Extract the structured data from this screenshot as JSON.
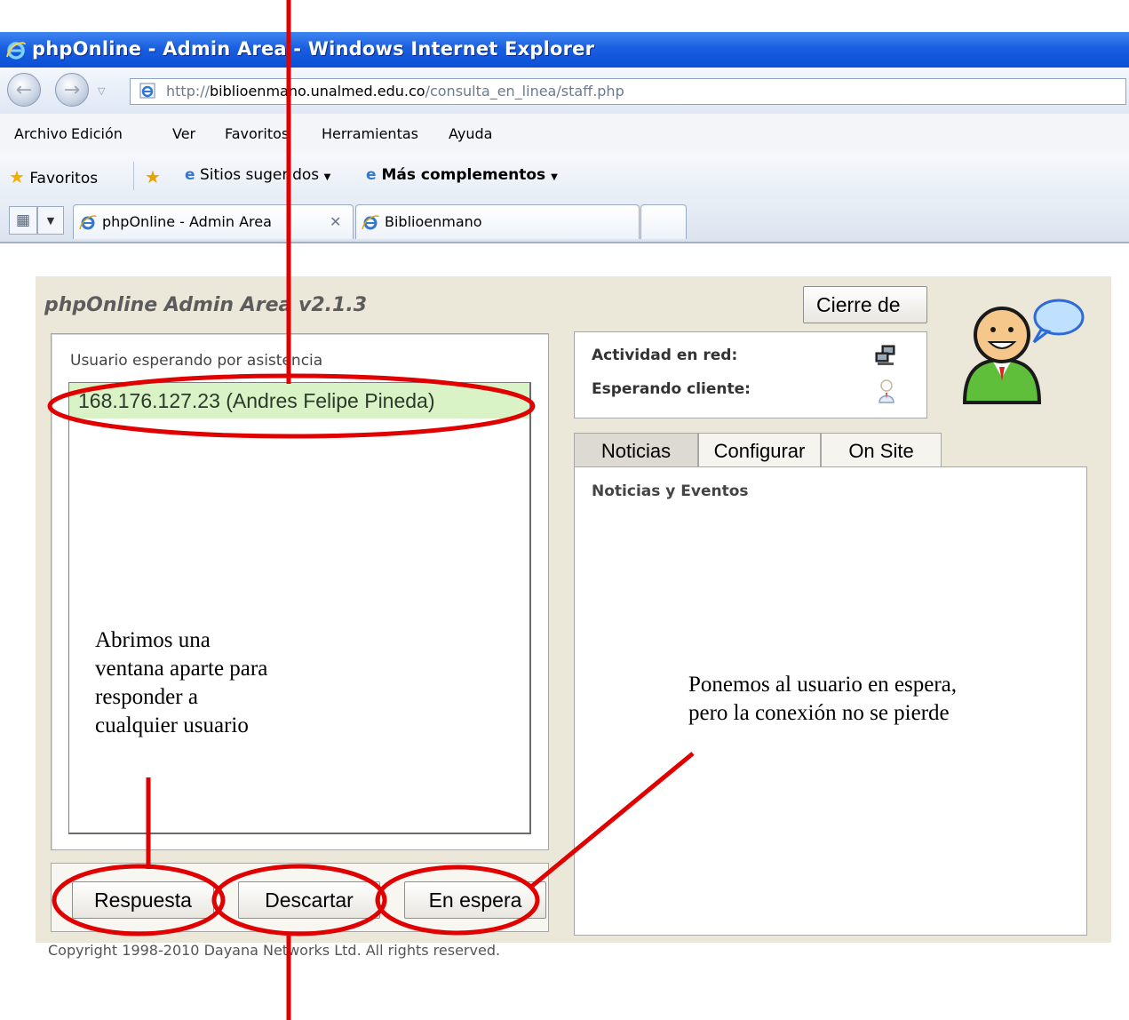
{
  "browser": {
    "window_title": "phpOnline - Admin Area - Windows Internet Explorer",
    "url": {
      "prefix": "http://",
      "host": "biblioenmano.unalmed.edu.co",
      "path": "/consulta_en_linea/staff.php"
    },
    "menu": [
      "Archivo",
      "Edición",
      "Ver",
      "Favoritos",
      "Herramientas",
      "Ayuda"
    ],
    "favorites_bar": {
      "favorites": "Favoritos",
      "suggested": "Sitios sugeridos",
      "addons": "Más complementos"
    },
    "tabs": [
      {
        "label": "phpOnline - Admin Area",
        "active": true
      },
      {
        "label": "Biblioenmano",
        "active": false
      }
    ]
  },
  "panel": {
    "title": "phpOnline Admin Area v2.1.3",
    "close_button": "Cierre de",
    "waiting": {
      "header": "Usuario esperando por asistencia",
      "items": [
        "168.176.127.23 (Andres Felipe Pineda)"
      ]
    },
    "buttons": {
      "respond": "Respuesta",
      "discard": "Descartar",
      "hold": "En espera"
    },
    "copyright": "Copyright 1998-2010 Dayana Networks Ltd. All rights reserved.",
    "status": {
      "network": "Actividad en red:",
      "waiting_client": "Esperando cliente:"
    },
    "tabs": [
      "Noticias",
      "Configurar",
      "On Site"
    ],
    "news_header": "Noticias y Eventos"
  },
  "annotations": {
    "respond_note": [
      "Abrimos una",
      "ventana aparte para",
      "responder a",
      "cualquier usuario"
    ],
    "hold_note": [
      "Ponemos al usuario en espera,",
      "pero la conexión no se pierde"
    ]
  },
  "colors": {
    "annotation": "#e00000",
    "title_bar": "#1a5fe0",
    "waiting_row": "#d9f3c6",
    "panel_bg": "#ebe7d9"
  }
}
